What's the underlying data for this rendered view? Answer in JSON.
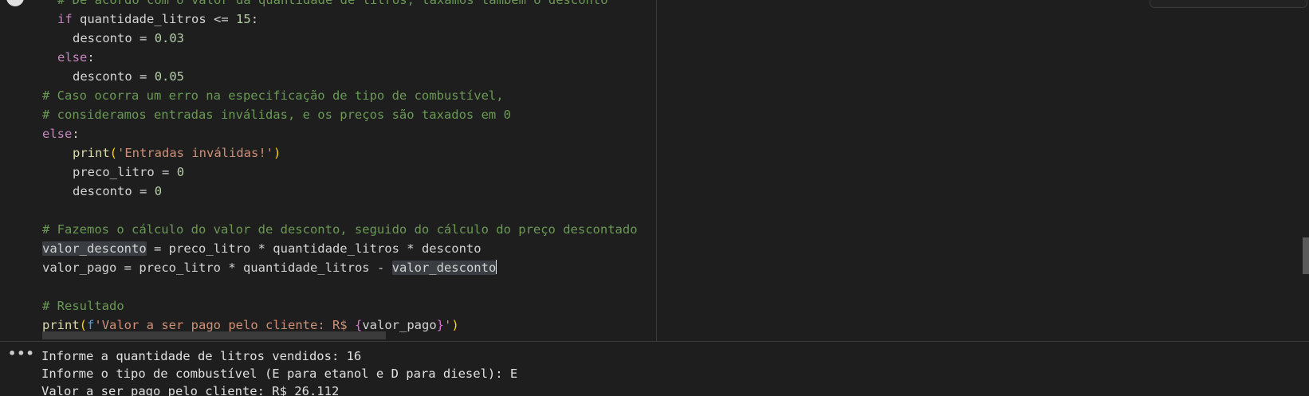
{
  "code": {
    "l0": {
      "comment": "# De acordo com o valor da quantidade de litros, taxamos também o desconto"
    },
    "l1": {
      "kw": "if",
      "var": "quantidade_litros",
      "op": "<=",
      "num": "15",
      "colon": ":"
    },
    "l2": {
      "var": "desconto",
      "op": "=",
      "num": "0.03"
    },
    "l3": {
      "kw": "else",
      "colon": ":"
    },
    "l4": {
      "var": "desconto",
      "op": "=",
      "num": "0.05"
    },
    "l5": {
      "comment": "# Caso ocorra um erro na especificação de tipo de combustível,"
    },
    "l6": {
      "comment": "# consideramos entradas inválidas, e os preços são taxados em 0"
    },
    "l7": {
      "kw": "else",
      "colon": ":"
    },
    "l8": {
      "fn": "print",
      "open": "(",
      "str": "'Entradas inválidas!'",
      "close": ")"
    },
    "l9": {
      "var": "preco_litro",
      "op": "=",
      "num": "0"
    },
    "l10": {
      "var": "desconto",
      "op": "=",
      "num": "0"
    },
    "l12": {
      "comment": "# Fazemos o cálculo do valor de desconto, seguido do cálculo do preço descontado"
    },
    "l13": {
      "var": "valor_desconto",
      "rest": "= preco_litro * quantidade_litros * desconto"
    },
    "l14": {
      "var": "valor_pago",
      "rest": "= preco_litro * quantidade_litros - ",
      "hl": "valor_desconto"
    },
    "l16": {
      "comment": "# Resultado"
    },
    "l17": {
      "fn": "print",
      "open": "(",
      "fpre": "f",
      "str": "'Valor a ser pago pelo cliente: R$ ",
      "bopen": "{",
      "var": "valor_pago",
      "bclose": "}",
      "strend": "'",
      "close": ")"
    }
  },
  "output": {
    "menu": "•••",
    "lines": [
      "Informe a quantidade de litros vendidos: 16",
      "Informe o tipo de combustível (E para etanol e D para diesel): E",
      "Valor a ser pago pelo cliente: R$ 26.112"
    ]
  },
  "colors": {
    "background": "#1e1e1e",
    "keyword": "#c586c0",
    "comment": "#6a9955",
    "number": "#b5cea8",
    "string": "#ce9178",
    "function": "#dcdcaa",
    "bracket": "#ffd700"
  }
}
